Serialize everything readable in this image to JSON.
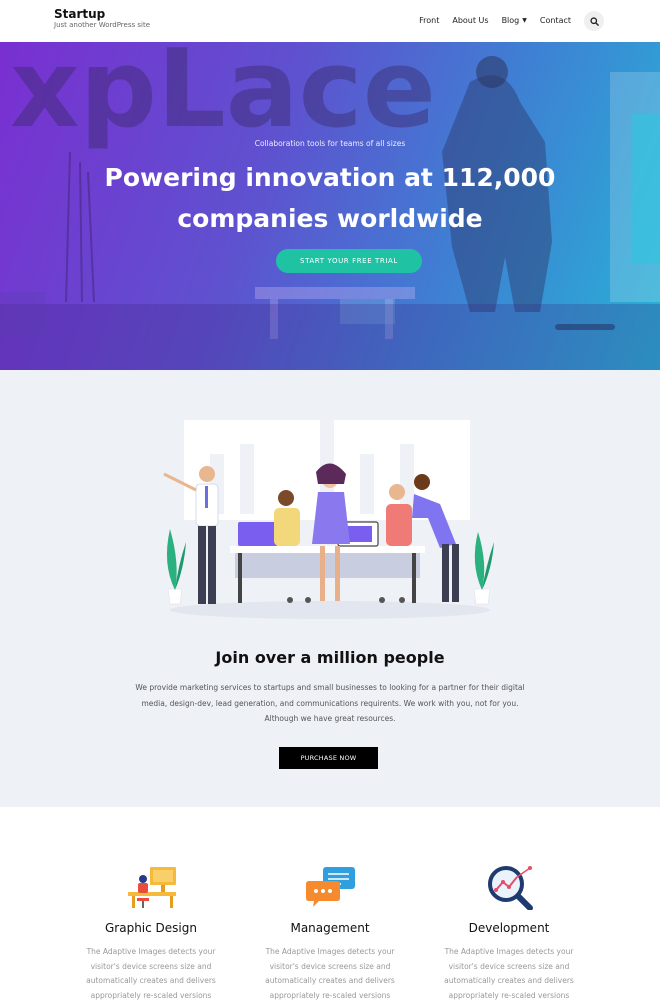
{
  "site": {
    "title": "Startup",
    "tagline": "Just another WordPress site"
  },
  "nav": {
    "items": [
      "Front",
      "About Us",
      "Blog",
      "Contact"
    ],
    "blog_has_dropdown": true,
    "search_icon": "search-icon"
  },
  "hero": {
    "background_sign_text": "xpLace",
    "kicker": "Collaboration tools for teams of all sizes",
    "title_line1": "Powering innovation at 112,000",
    "title_line2": "companies worldwide",
    "cta": "START YOUR FREE TRIAL",
    "colors": {
      "gradient_start": "#7a2fd1",
      "gradient_end": "#27b3d6",
      "cta": "#1fc3a4"
    }
  },
  "join": {
    "title": "Join over a million people",
    "body_line1": "We provide marketing services to startups and small businesses to looking for a partner for their digital",
    "body_line2": "media, design-dev, lead generation, and communications requirents. We work with you, not for you.",
    "body_line3": "Although we have great resources.",
    "button": "PURCHASE NOW"
  },
  "features": [
    {
      "title": "Graphic Design",
      "icon": "design-desk-icon",
      "desc_line1": "The Adaptive Images detects your",
      "desc_line2": "visitor's device screens size and",
      "desc_line3": "automatically creates and delivers",
      "desc_line4": "appropriately re-scaled versions"
    },
    {
      "title": "Management",
      "icon": "chat-bubbles-icon",
      "desc_line1": "The Adaptive Images detects your",
      "desc_line2": "visitor's device screens size and",
      "desc_line3": "automatically creates and delivers",
      "desc_line4": "appropriately re-scaled versions"
    },
    {
      "title": "Development",
      "icon": "magnifier-chart-icon",
      "desc_line1": "The Adaptive Images detects your",
      "desc_line2": "visitor's device screens size and",
      "desc_line3": "automatically creates and delivers",
      "desc_line4": "appropriately re-scaled versions"
    }
  ]
}
